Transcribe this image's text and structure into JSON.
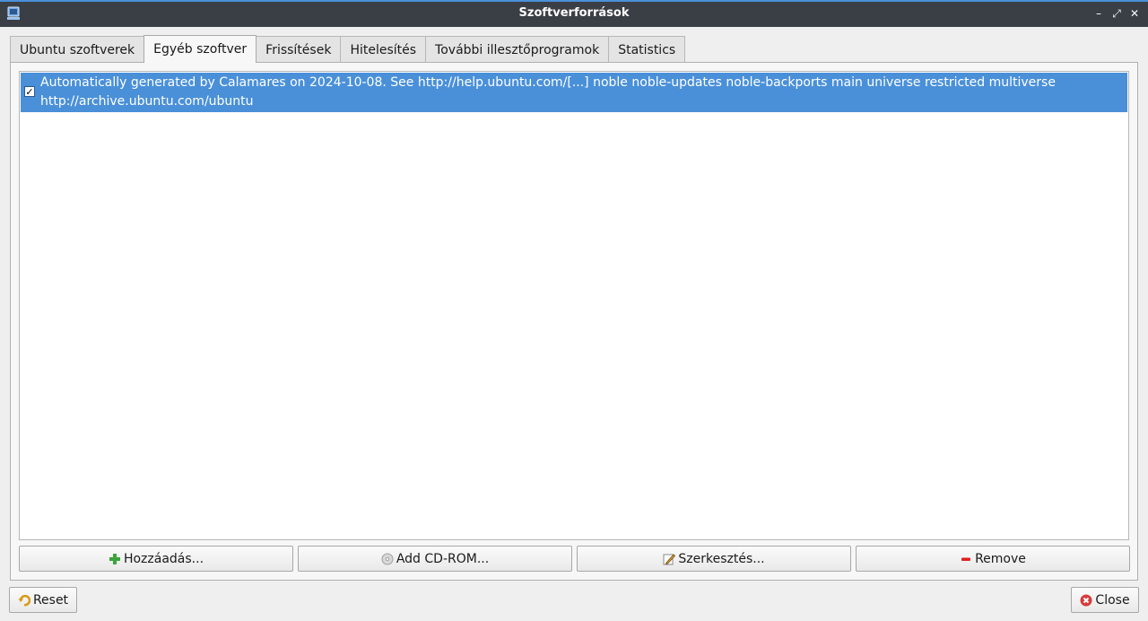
{
  "window": {
    "title": "Szoftverforrások",
    "controls": {
      "minimize": "–",
      "maximize": "⤢",
      "close": "✕"
    }
  },
  "tabs": [
    {
      "label": "Ubuntu szoftverek",
      "active": false
    },
    {
      "label": "Egyéb szoftver",
      "active": true
    },
    {
      "label": "Frissítések",
      "active": false
    },
    {
      "label": "Hitelesítés",
      "active": false
    },
    {
      "label": "További illesztőprogramok",
      "active": false
    },
    {
      "label": "Statistics",
      "active": false
    }
  ],
  "sources": [
    {
      "checked": true,
      "selected": true,
      "line1": "Automatically generated by Calamares on 2024-10-08.  See http://help.ubuntu.com/[...] noble noble-updates noble-backports main universe restricted multiverse",
      "line2": "http://archive.ubuntu.com/ubuntu"
    }
  ],
  "buttons": {
    "add": {
      "label": "Hozzáadás...",
      "icon": "plus-icon"
    },
    "add_cdrom": {
      "label": "Add CD-ROM...",
      "icon": "cdrom-icon"
    },
    "edit": {
      "label": "Szerkesztés...",
      "icon": "pencil-icon"
    },
    "remove": {
      "label": "Remove",
      "icon": "minus-icon"
    },
    "reset": {
      "label": "Reset",
      "icon": "undo-icon"
    },
    "close": {
      "label": "Close",
      "icon": "close-circle-icon"
    }
  },
  "colors": {
    "titlebar": "#3a3f46",
    "accent": "#4a90d9",
    "add_icon": "#3aa53a",
    "remove_icon": "#e02020",
    "close_icon": "#d83a3a"
  }
}
